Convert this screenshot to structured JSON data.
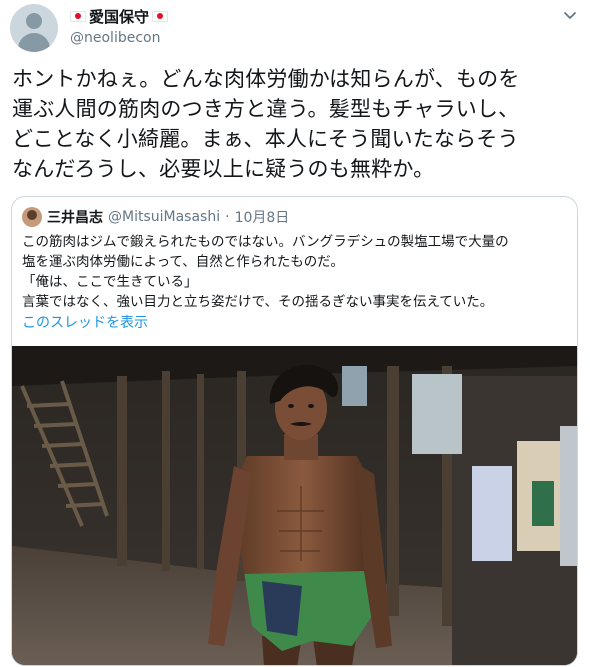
{
  "tweet": {
    "display_name": "愛国保守",
    "handle": "@neolibecon",
    "text_lines": [
      "ホントかねぇ。どんな肉体労働かは知らんが、ものを",
      "運ぶ人間の筋肉のつき方と違う。髪型もチャラいし、",
      "どことなく小綺麗。まぁ、本人にそう聞いたならそう",
      "なんだろうし、必要以上に疑うのも無粋か。"
    ]
  },
  "quote": {
    "name": "三井昌志",
    "handle": "@MitsuiMasashi",
    "separator": "·",
    "date": "10月8日",
    "text_lines": [
      "この筋肉はジムで鍛えられたものではない。バングラデシュの製塩工場で大量の",
      "塩を運ぶ肉体労働によって、自然と作られたものだ。",
      "「俺は、ここで生きている」",
      "言葉ではなく、強い目力と立ち姿だけで、その揺るぎない事実を伝えていた。"
    ],
    "thread_link": "このスレッドを表示"
  },
  "icons": {
    "avatar": "default-avatar-icon",
    "caret": "chevron-down-icon",
    "flag": "japan-flag-icon"
  },
  "colors": {
    "link": "#1b95e0",
    "secondary_text": "#657786",
    "border": "#ccd6dd"
  }
}
